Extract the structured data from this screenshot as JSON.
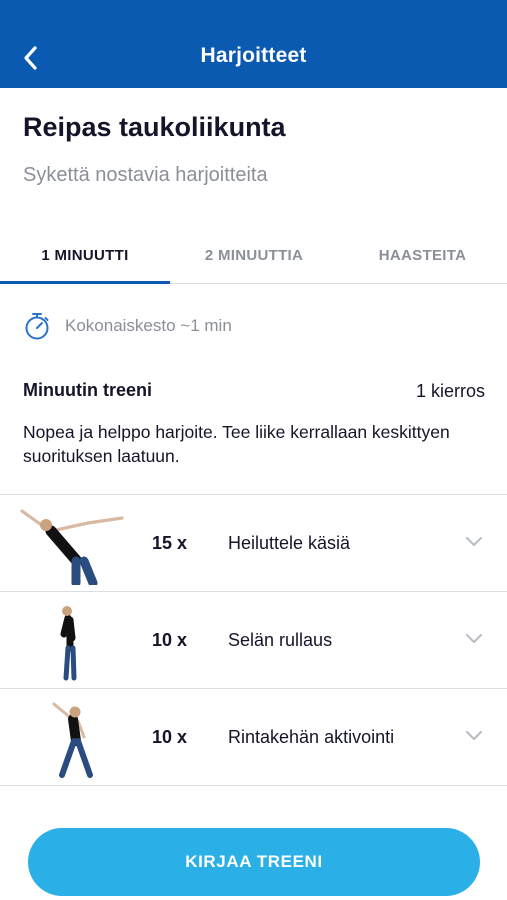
{
  "header": {
    "title": "Harjoitteet",
    "back_icon": "chevron-left-icon",
    "background": "#0b5ab1"
  },
  "program": {
    "title": "Reipas taukoliikunta",
    "subtitle": "Sykettä nostavia harjoitteita"
  },
  "tabs": [
    {
      "label": "1 MINUUTTI",
      "active": true
    },
    {
      "label": "2 MINUUTTIA",
      "active": false
    },
    {
      "label": "HAASTEITA",
      "active": false
    }
  ],
  "duration": {
    "icon": "stopwatch-icon",
    "text": "Kokonaiskesto ~1 min"
  },
  "workout": {
    "name": "Minuutin treeni",
    "rounds": "1 kierros",
    "description": "Nopea ja helppo harjoite. Tee liike kerrallaan keskittyen suorituksen laatuun."
  },
  "exercises": [
    {
      "reps": "15 x",
      "name": "Heiluttele käsiä",
      "icon": "chevron-down-icon"
    },
    {
      "reps": "10 x",
      "name": "Selän rullaus",
      "icon": "chevron-down-icon"
    },
    {
      "reps": "10 x",
      "name": "Rintakehän aktivointi",
      "icon": "chevron-down-icon"
    }
  ],
  "cta": {
    "label": "KIRJAA TREENI",
    "color": "#2ab0e6"
  }
}
